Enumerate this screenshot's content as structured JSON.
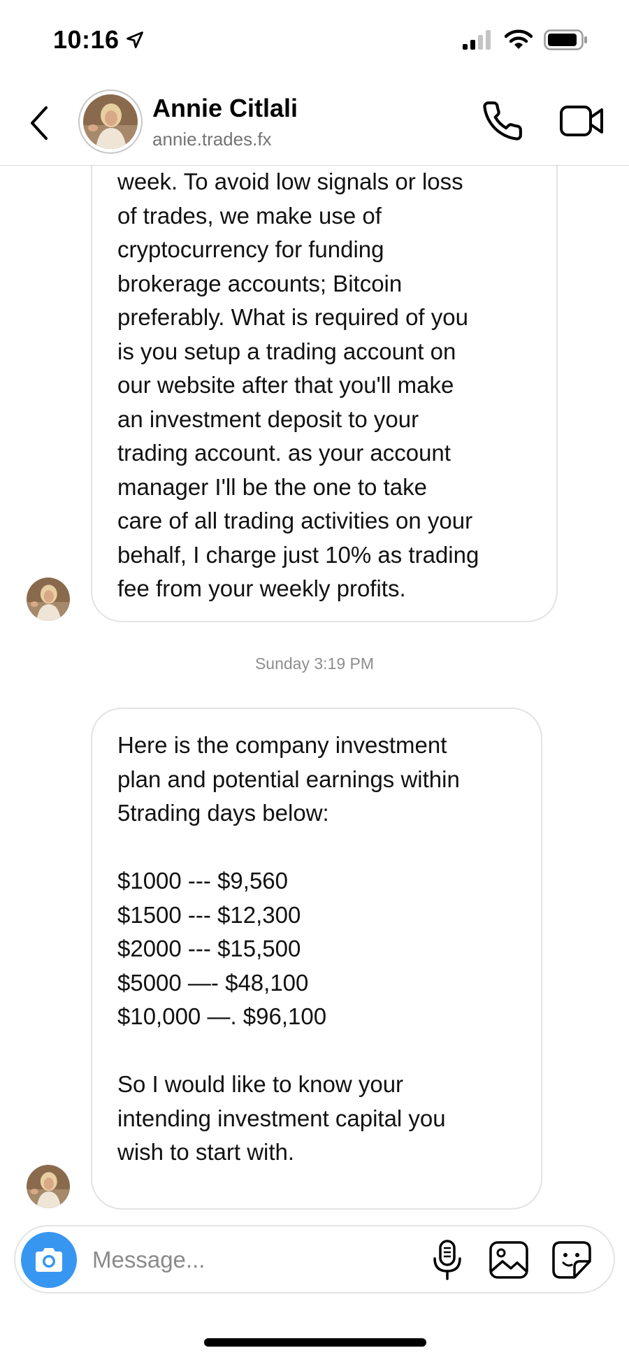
{
  "status_bar": {
    "time": "10:16"
  },
  "header": {
    "name": "Annie Citlali",
    "username": "annie.trades.fx"
  },
  "messages": [
    {
      "sender": "Annie Citlali",
      "text": "week. To avoid low signals or loss\nof trades, we make use of\ncryptocurrency for funding\nbrokerage accounts; Bitcoin\npreferably. What is required of you\nis you setup a trading account on\nour website after that you'll make\nan investment deposit to your\ntrading account. as your account\nmanager I'll be the one to take\ncare of all trading activities on your\nbehalf, I charge just 10% as trading\nfee from your weekly profits."
    },
    {
      "sender": "Annie Citlali",
      "text": "Here is the company investment\nplan and potential earnings within\n5trading days below:\n\n$1000  ---    $9,560\n$1500  ---    $12,300\n$2000  ---    $15,500\n$5000  —-   $48,100\n$10,000 —.  $96,100\n\nSo I would like to know your\nintending investment capital you\nwish to start with."
    }
  ],
  "timestamp": "Sunday 3:19 PM",
  "composer": {
    "placeholder": "Message..."
  },
  "colors": {
    "accent": "#3797f0",
    "bubble_border": "#e3e3e3",
    "secondary_text": "#737373"
  }
}
